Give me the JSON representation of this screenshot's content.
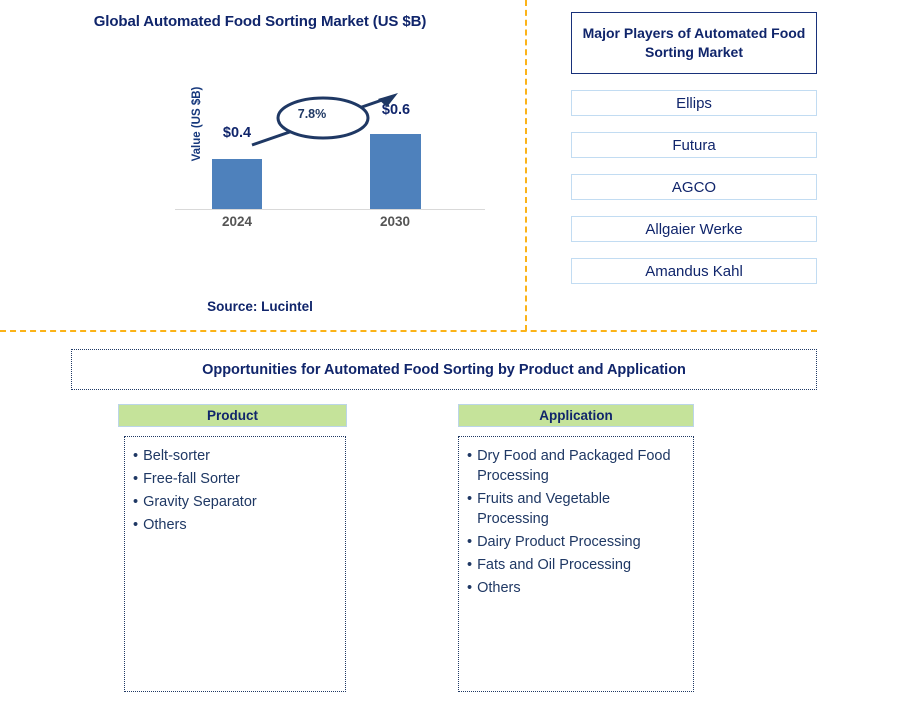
{
  "chart_panel": {
    "title": "Global Automated Food Sorting Market (US $B)",
    "y_axis_label": "Value (US $B)",
    "cagr_label": "7.8%",
    "source": "Source: Lucintel"
  },
  "chart_data": {
    "type": "bar",
    "title": "Global Automated Food Sorting Market (US $B)",
    "categories": [
      "2024",
      "2030"
    ],
    "values": [
      0.4,
      0.6
    ],
    "value_labels": [
      "$0.4",
      "$0.6"
    ],
    "xlabel": "",
    "ylabel": "Value (US $B)",
    "ylim": [
      0,
      0.7
    ],
    "grid": false,
    "legend": "none",
    "bar_color": "#4E81BC",
    "annotations": [
      {
        "text": "7.8%",
        "kind": "cagr-ellipse-arrow",
        "from": "2024",
        "to": "2030"
      }
    ]
  },
  "players": {
    "header": "Major Players of Automated Food Sorting Market",
    "items": [
      {
        "name": "Ellips"
      },
      {
        "name": "Futura"
      },
      {
        "name": "AGCO"
      },
      {
        "name": "Allgaier Werke"
      },
      {
        "name": "Amandus Kahl"
      }
    ]
  },
  "opportunities": {
    "banner": "Opportunities for Automated Food Sorting by Product and Application",
    "bullet_glyph": "•",
    "columns": [
      {
        "header": "Product",
        "items": [
          "Belt-sorter",
          "Free-fall Sorter",
          "Gravity Separator",
          "Others"
        ]
      },
      {
        "header": "Application",
        "items": [
          "Dry Food and Packaged Food Processing",
          "Fruits and Vegetable Processing",
          "Dairy Product Processing",
          "Fats and Oil Processing",
          "Others"
        ]
      }
    ]
  },
  "colors": {
    "navy": "#10256B",
    "bar_blue": "#4E81BC",
    "divider_orange": "#FBB318",
    "header_green": "#C5E39A",
    "player_border": "#C2DCF2"
  }
}
